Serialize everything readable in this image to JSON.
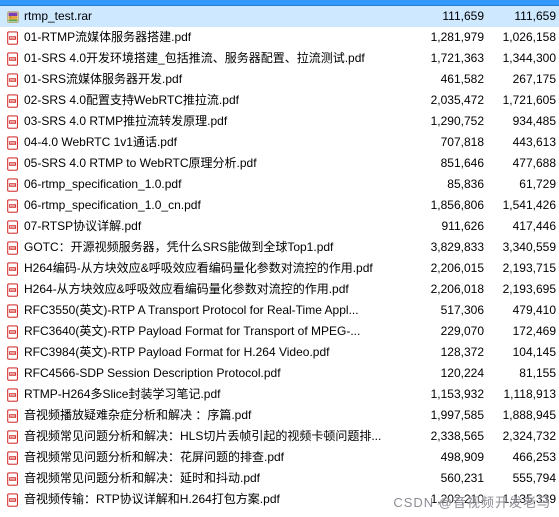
{
  "watermark": "CSDN @音视频开发老马",
  "files": [
    {
      "icon": "rar",
      "name": "rtmp_test.rar",
      "size1": "111,659",
      "size2": "111,659",
      "selected": true
    },
    {
      "icon": "pdf",
      "name": "01-RTMP流媒体服务器搭建.pdf",
      "size1": "1,281,979",
      "size2": "1,026,158"
    },
    {
      "icon": "pdf",
      "name": "01-SRS 4.0开发环境搭建_包括推流、服务器配置、拉流测试.pdf",
      "size1": "1,721,363",
      "size2": "1,344,300"
    },
    {
      "icon": "pdf",
      "name": "01-SRS流媒体服务器开发.pdf",
      "size1": "461,582",
      "size2": "267,175"
    },
    {
      "icon": "pdf",
      "name": "02-SRS 4.0配置支持WebRTC推拉流.pdf",
      "size1": "2,035,472",
      "size2": "1,721,605"
    },
    {
      "icon": "pdf",
      "name": "03-SRS 4.0 RTMP推拉流转发原理.pdf",
      "size1": "1,290,752",
      "size2": "934,485"
    },
    {
      "icon": "pdf",
      "name": "04-4.0 WebRTC 1v1通话.pdf",
      "size1": "707,818",
      "size2": "443,613"
    },
    {
      "icon": "pdf",
      "name": "05-SRS 4.0 RTMP to WebRTC原理分析.pdf",
      "size1": "851,646",
      "size2": "477,688"
    },
    {
      "icon": "pdf",
      "name": "06-rtmp_specification_1.0.pdf",
      "size1": "85,836",
      "size2": "61,729"
    },
    {
      "icon": "pdf",
      "name": "06-rtmp_specification_1.0_cn.pdf",
      "size1": "1,856,806",
      "size2": "1,541,426"
    },
    {
      "icon": "pdf",
      "name": "07-RTSP协议详解.pdf",
      "size1": "911,626",
      "size2": "417,446"
    },
    {
      "icon": "pdf",
      "name": "GOTC：开源视频服务器，凭什么SRS能做到全球Top1.pdf",
      "size1": "3,829,833",
      "size2": "3,340,559"
    },
    {
      "icon": "pdf",
      "name": "H264编码-从方块效应&呼吸效应看编码量化参数对流控的作用.pdf",
      "size1": "2,206,015",
      "size2": "2,193,715"
    },
    {
      "icon": "pdf",
      "name": "H264-从方块效应&呼吸效应看编码量化参数对流控的作用.pdf",
      "size1": "2,206,018",
      "size2": "2,193,695"
    },
    {
      "icon": "pdf",
      "name": "RFC3550(英文)-RTP A Transport Protocol for Real-Time Appl...",
      "size1": "517,306",
      "size2": "479,410"
    },
    {
      "icon": "pdf",
      "name": "RFC3640(英文)-RTP Payload Format for Transport of MPEG-...",
      "size1": "229,070",
      "size2": "172,469"
    },
    {
      "icon": "pdf",
      "name": "RFC3984(英文)-RTP Payload Format for H.264 Video.pdf",
      "size1": "128,372",
      "size2": "104,145"
    },
    {
      "icon": "pdf",
      "name": "RFC4566-SDP Session  Description  Protocol.pdf",
      "size1": "120,224",
      "size2": "81,155"
    },
    {
      "icon": "pdf",
      "name": "RTMP-H264多Slice封装学习笔记.pdf",
      "size1": "1,153,932",
      "size2": "1,118,913"
    },
    {
      "icon": "pdf",
      "name": "音视频播放疑难杂症分析和解决 ：序篇.pdf",
      "size1": "1,997,585",
      "size2": "1,888,945"
    },
    {
      "icon": "pdf",
      "name": "音视频常见问题分析和解决：HLS切片丢帧引起的视频卡顿问题排...",
      "size1": "2,338,565",
      "size2": "2,324,732"
    },
    {
      "icon": "pdf",
      "name": "音视频常见问题分析和解决：花屏问题的排查.pdf",
      "size1": "498,909",
      "size2": "466,253"
    },
    {
      "icon": "pdf",
      "name": "音视频常见问题分析和解决：延时和抖动.pdf",
      "size1": "560,231",
      "size2": "555,794"
    },
    {
      "icon": "pdf",
      "name": "音视频传输：RTP协议详解和H.264打包方案.pdf",
      "size1": "1,202,210",
      "size2": "1,135,339"
    }
  ]
}
